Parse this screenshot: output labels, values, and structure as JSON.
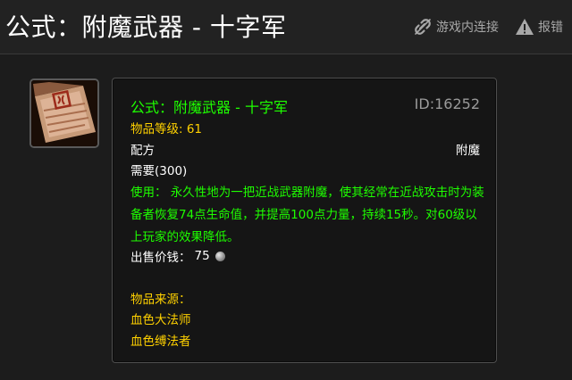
{
  "header": {
    "title": "公式：附魔武器 - 十字军",
    "ingame_link_label": "游戏内连接",
    "report_label": "报错",
    "ingame_link_icon": "link-icon",
    "report_icon": "warning-icon"
  },
  "item": {
    "icon": "recipe-scroll-icon",
    "name": "公式：附魔武器 - 十字军",
    "id_text": "ID:16252",
    "item_level_text": "物品等级: 61",
    "type": "配方",
    "subtype": "附魔",
    "requirement": "需要(300)",
    "use_text": "使用： 永久性地为一把近战武器附魔，使其经常在近战攻击时为装备者恢复74点生命值，并提高100点力量，持续15秒。对60级以上玩家的效果降低。",
    "sell_label": "出售价钱：",
    "sell_value": "75",
    "sell_coin": "silver-coin-icon",
    "source_label": "物品来源：",
    "sources": [
      "血色大法师",
      "血色缚法者"
    ]
  },
  "colors": {
    "name_green": "#1eff00",
    "level_gold": "#ffd100",
    "id_gray": "#9a9a9a",
    "background": "#1c1c1c",
    "tooltip_bg": "#151515"
  }
}
